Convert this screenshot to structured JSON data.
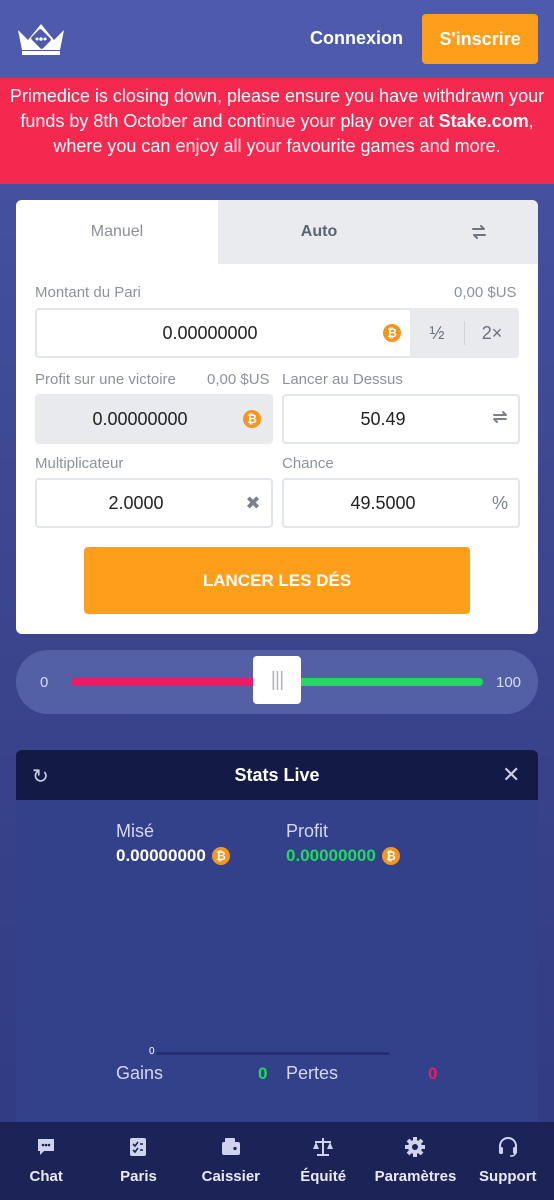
{
  "header": {
    "login_label": "Connexion",
    "signup_label": "S'inscrire"
  },
  "banner": {
    "text_before": "Primedice is closing down, please ensure you have withdrawn your funds by 8th October and continue your play over at ",
    "link": "Stake.com",
    "text_after": ", where you can enjoy all your favourite games and more."
  },
  "tabs": {
    "manual": "Manuel",
    "auto": "Auto",
    "switch_icon": "swap-icon"
  },
  "bet": {
    "label": "Montant du Pari",
    "usd": "0,00 $US",
    "value": "0.00000000",
    "half": "½",
    "double": "2×"
  },
  "profit": {
    "label": "Profit sur une victoire",
    "usd": "0,00 $US",
    "value": "0.00000000"
  },
  "roll_over": {
    "label": "Lancer au Dessus",
    "value": "50.49"
  },
  "multiplier": {
    "label": "Multiplicateur",
    "value": "2.0000"
  },
  "chance": {
    "label": "Chance",
    "value": "49.5000",
    "unit": "%"
  },
  "roll_button": "LANCER LES DÉS",
  "slider": {
    "min": "0",
    "max": "100",
    "value": 50.49
  },
  "stats": {
    "title": "Stats Live",
    "wagered_label": "Misé",
    "wagered_value": "0.00000000",
    "profit_label": "Profit",
    "profit_value": "0.00000000",
    "chart_zero": "0",
    "wins_label": "Gains",
    "wins_value": "0",
    "losses_label": "Pertes",
    "losses_value": "0"
  },
  "colors": {
    "accent": "#ff9e1b",
    "alert": "#f5294f",
    "win": "#22d95e",
    "loss": "#ee1b64"
  },
  "nav": [
    {
      "label": "Chat",
      "icon": "chat-icon"
    },
    {
      "label": "Paris",
      "icon": "bets-icon"
    },
    {
      "label": "Caissier",
      "icon": "wallet-icon"
    },
    {
      "label": "Équité",
      "icon": "scale-icon"
    },
    {
      "label": "Paramètres",
      "icon": "gear-icon"
    },
    {
      "label": "Support",
      "icon": "headset-icon"
    }
  ]
}
